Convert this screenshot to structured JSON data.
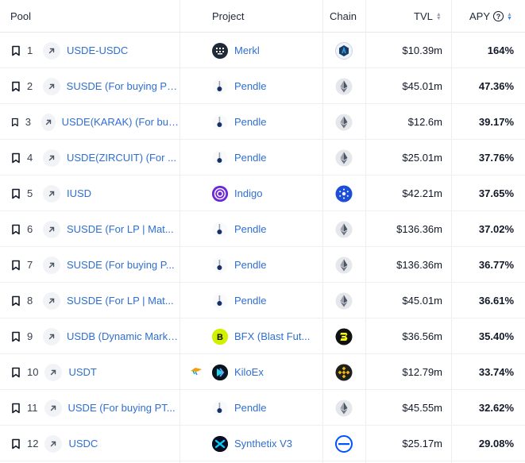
{
  "header": {
    "pool": "Pool",
    "project": "Project",
    "chain": "Chain",
    "tvl": "TVL",
    "apy": "APY",
    "apy_help": "?"
  },
  "rows": [
    {
      "rank": "1",
      "pool": "USDE-USDC",
      "project": "Merkl",
      "project_logo": "merkl",
      "chain": "arbitrum",
      "tvl": "$10.39m",
      "apy": "164%"
    },
    {
      "rank": "2",
      "pool": "SUSDE (For buying PT...",
      "project": "Pendle",
      "project_logo": "pendle",
      "chain": "ethereum",
      "tvl": "$45.01m",
      "apy": "47.36%"
    },
    {
      "rank": "3",
      "pool": "USDE(KARAK) (For buying PT)",
      "project": "Pendle",
      "project_logo": "pendle",
      "chain": "ethereum",
      "tvl": "$12.6m",
      "apy": "39.17%"
    },
    {
      "rank": "4",
      "pool": "USDE(ZIRCUIT) (For ...",
      "project": "Pendle",
      "project_logo": "pendle",
      "chain": "ethereum",
      "tvl": "$25.01m",
      "apy": "37.76%"
    },
    {
      "rank": "5",
      "pool": "IUSD",
      "project": "Indigo",
      "project_logo": "indigo",
      "chain": "cardano",
      "tvl": "$42.21m",
      "apy": "37.65%"
    },
    {
      "rank": "6",
      "pool": "SUSDE (For LP | Mat...",
      "project": "Pendle",
      "project_logo": "pendle",
      "chain": "ethereum",
      "tvl": "$136.36m",
      "apy": "37.02%"
    },
    {
      "rank": "7",
      "pool": "SUSDE (For buying P...",
      "project": "Pendle",
      "project_logo": "pendle",
      "chain": "ethereum",
      "tvl": "$136.36m",
      "apy": "36.77%"
    },
    {
      "rank": "8",
      "pool": "SUSDE (For LP | Mat...",
      "project": "Pendle",
      "project_logo": "pendle",
      "chain": "ethereum",
      "tvl": "$45.01m",
      "apy": "36.61%"
    },
    {
      "rank": "9",
      "pool": "USDB (Dynamic Market)",
      "project": "BFX (Blast Fut...",
      "project_logo": "bfx",
      "chain": "blast",
      "tvl": "$36.56m",
      "apy": "35.40%"
    },
    {
      "rank": "10",
      "pool": "USDT",
      "project": "KiloEx",
      "project_logo": "kiloex",
      "chain": "bnb",
      "tvl": "$12.79m",
      "apy": "33.74%",
      "reward_icon": true
    },
    {
      "rank": "11",
      "pool": "USDE (For buying PT...",
      "project": "Pendle",
      "project_logo": "pendle",
      "chain": "ethereum",
      "tvl": "$45.55m",
      "apy": "32.62%"
    },
    {
      "rank": "12",
      "pool": "USDC",
      "project": "Synthetix V3",
      "project_logo": "synthetix",
      "chain": "base",
      "tvl": "$25.17m",
      "apy": "29.08%"
    }
  ],
  "colors": {
    "link": "#2f6fd1",
    "sort_active": "#3b82f6",
    "divider": "#e5e7eb"
  }
}
